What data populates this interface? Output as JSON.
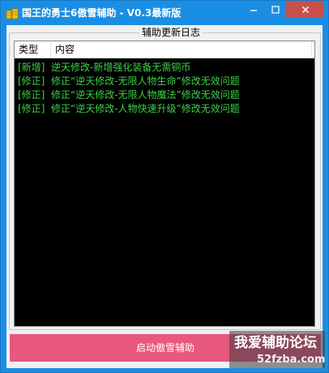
{
  "window": {
    "title": "国王的勇士6傲雪辅助 - V0.3最新版",
    "icons": {
      "app": "coin-stack-icon",
      "minimize": "minimize-icon",
      "maximize": "maximize-icon",
      "close": "close-icon"
    },
    "colors": {
      "titlebar": "#1a8ee3",
      "close": "#c7504b"
    }
  },
  "log_group": {
    "title": "辅助更新日志",
    "columns": [
      "类型",
      "内容"
    ],
    "rows": [
      {
        "type": "[新增]",
        "content": "逆天修改-新增强化装备无需铜币"
      },
      {
        "type": "[修正]",
        "content": "修正“逆天修改-无限人物生命”修改无效问题"
      },
      {
        "type": "[修正]",
        "content": "修正“逆天修改-无限人物魔法”修改无效问题"
      },
      {
        "type": "[修正]",
        "content": "修正“逆天修改-人物快速升级”修改无效问题"
      }
    ],
    "colors": {
      "background": "#000000",
      "text": "#3dd148"
    }
  },
  "start_button": {
    "label": "启动傲雪辅助",
    "color": "#e8577e"
  },
  "watermark": {
    "line1": "我爱辅助论坛",
    "line2": "52fzba.com"
  }
}
